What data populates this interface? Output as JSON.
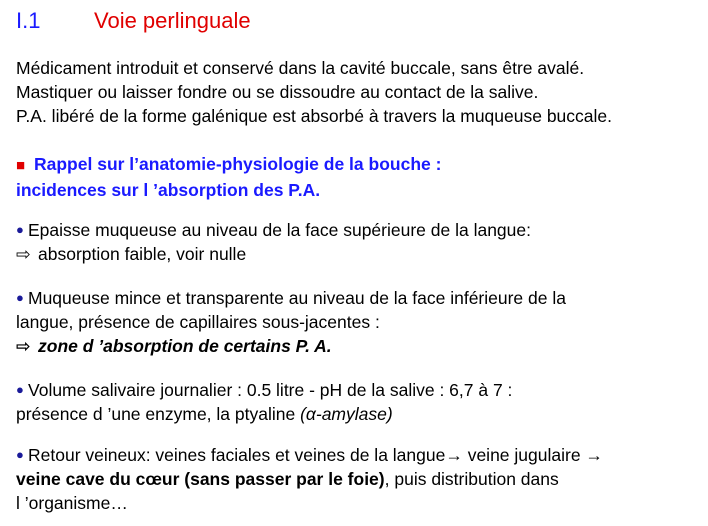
{
  "heading": {
    "number": "I.1",
    "title": "Voie perlinguale"
  },
  "intro": [
    "Médicament introduit et conservé dans la cavité buccale, sans  être avalé.",
    "Mastiquer ou laisser fondre ou se dissoudre au contact de la salive.",
    "P.A. libéré de la forme galénique est absorbé à travers la muqueuse buccale."
  ],
  "rappel": {
    "marker": "■",
    "line1": "Rappel sur l’anatomie-physiologie de la bouche :",
    "line2": "incidences sur l ’absorption des P.A."
  },
  "points": {
    "p1": {
      "bullet": "●",
      "line1": "Epaisse muqueuse au niveau de la face supérieure de la langue:",
      "arrow": "⇨",
      "line2": "absorption faible, voir nulle"
    },
    "p2": {
      "bullet": "●",
      "line1": "Muqueuse mince et transparente au niveau de la face inférieure de la",
      "line2": "langue, présence de capillaires sous-jacentes :",
      "arrow": "⇨",
      "line3": "zone d ’absorption de certains P. A."
    },
    "p3": {
      "bullet": "●",
      "line1": "Volume salivaire journalier : 0.5 litre - pH de la salive : 6,7 à 7 :",
      "line2_start": "présence d ’une enzyme, la ptyaline ",
      "line2_paren_open": "(",
      "line2_alpha": "α",
      "line2_italic": "-amylase",
      "line2_paren_close": ")"
    },
    "p4": {
      "bullet": "●",
      "line1": "Retour veineux: veines faciales et veines de la langue→ veine jugulaire →",
      "line2_bold": "veine cave du cœur (sans passer par le foie)",
      "line2_rest": ", puis distribution dans",
      "line3": "l ’organisme…"
    }
  }
}
